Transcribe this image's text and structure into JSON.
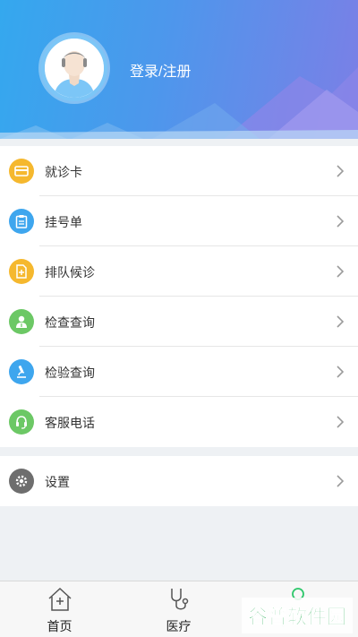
{
  "header": {
    "login_label": "登录/注册",
    "avatar_icon": "user-avatar-icon"
  },
  "menu": [
    {
      "label": "就诊卡",
      "icon": "card-icon",
      "color": "#f5b82e"
    },
    {
      "label": "挂号单",
      "icon": "clipboard-icon",
      "color": "#3ea6ee"
    },
    {
      "label": "排队候诊",
      "icon": "queue-document-icon",
      "color": "#f5b82e"
    },
    {
      "label": "检查查询",
      "icon": "doctor-icon",
      "color": "#6cc865"
    },
    {
      "label": "检验查询",
      "icon": "microscope-icon",
      "color": "#3ea6ee"
    },
    {
      "label": "客服电话",
      "icon": "headset-icon",
      "color": "#6cc865"
    }
  ],
  "settings": {
    "label": "设置",
    "icon": "gear-icon",
    "color": "#6e6e6e"
  },
  "tabbar": [
    {
      "label": "首页",
      "icon": "home-plus-icon"
    },
    {
      "label": "医疗",
      "icon": "stethoscope-icon"
    },
    {
      "label": "",
      "icon": "profile-icon",
      "active_color": "#2cc76a"
    }
  ],
  "watermark": {
    "text": "谷普软件园",
    "color": "#1aa84a"
  }
}
